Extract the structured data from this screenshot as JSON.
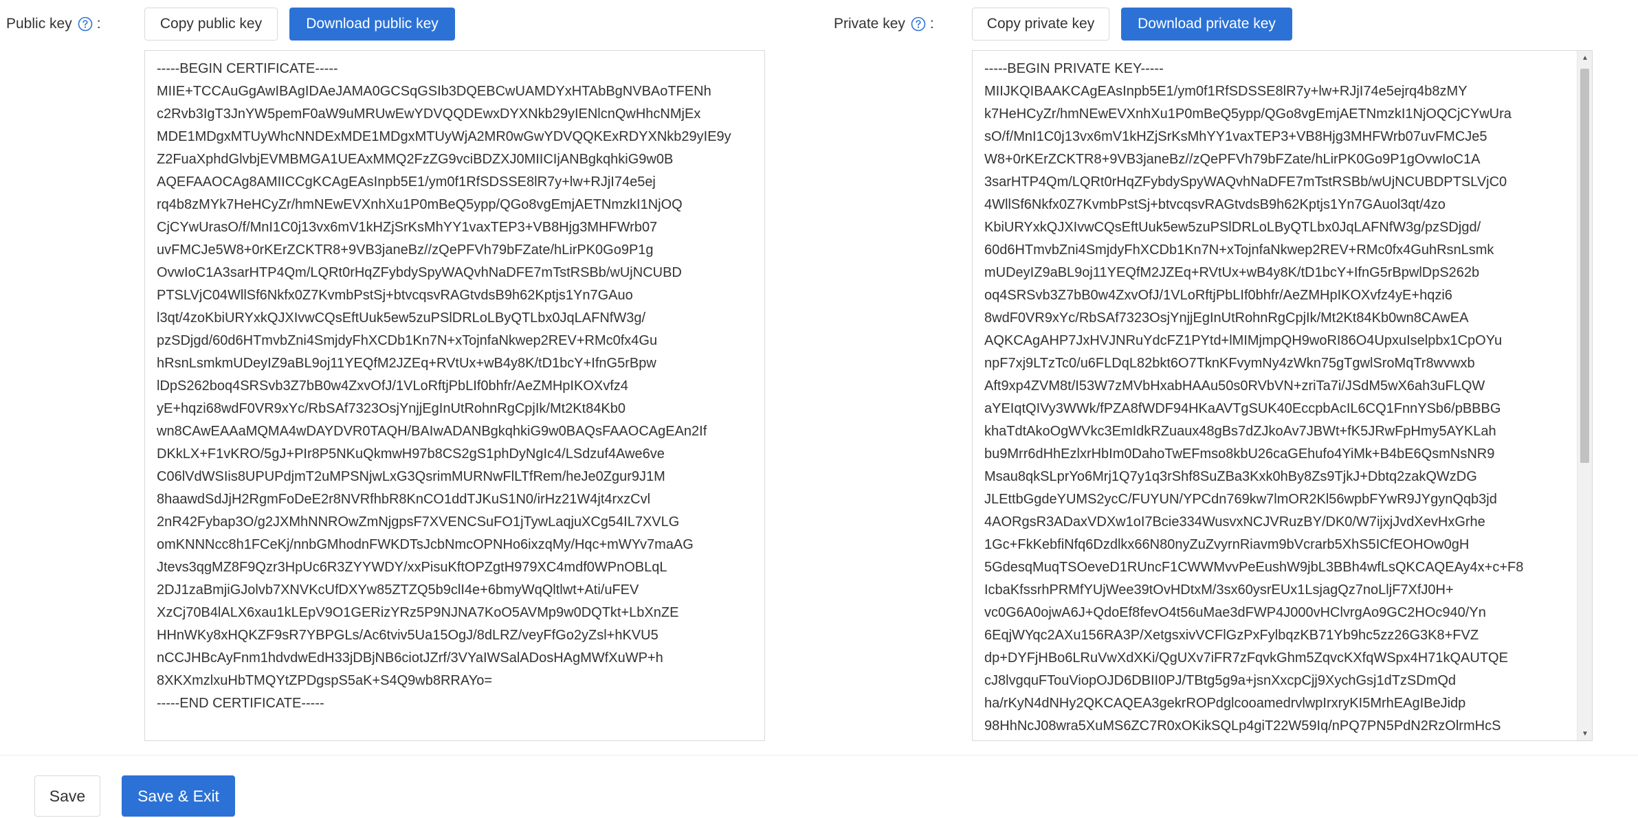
{
  "public_key": {
    "label": "Public key",
    "colon": ":",
    "copy_label": "Copy public key",
    "download_label": "Download public key",
    "content": "-----BEGIN CERTIFICATE-----\nMIIE+TCCAuGgAwIBAgIDAeJAMA0GCSqGSIb3DQEBCwUAMDYxHTAbBgNVBAoTFENh\nc2Rvb3IgT3JnYW5pemF0aW9uMRUwEwYDVQQDEwxDYXNkb29yIENlcnQwHhcNMjEx\nMDE1MDgxMTUyWhcNNDExMDE1MDgxMTUyWjA2MR0wGwYDVQQKExRDYXNkb29yIE9y\nZ2FuaXphdGlvbjEVMBMGA1UEAxMMQ2FzZG9vciBDZXJ0MIICIjANBgkqhkiG9w0B\nAQEFAAOCAg8AMIICCgKCAgEAsInpb5E1/ym0f1RfSDSSE8lR7y+lw+RJjI74e5ej\nrq4b8zMYk7HeHCyZr/hmNEwEVXnhXu1P0mBeQ5ypp/QGo8vgEmjAETNmzkI1NjOQ\nCjCYwUrasO/f/MnI1C0j13vx6mV1kHZjSrKsMhYY1vaxTEP3+VB8Hjg3MHFWrb07\nuvFMCJe5W8+0rKErZCKTR8+9VB3janeBz//zQePFVh79bFZate/hLirPK0Go9P1g\nOvwIoC1A3sarHTP4Qm/LQRt0rHqZFybdySpyWAQvhNaDFE7mTstRSBb/wUjNCUBD\nPTSLVjC04WllSf6Nkfx0Z7KvmbPstSj+btvcqsvRAGtvdsB9h62Kptjs1Yn7GAuo\nl3qt/4zoKbiURYxkQJXIvwCQsEftUuk5ew5zuPSlDRLoLByQTLbx0JqLAFNfW3g/\npzSDjgd/60d6HTmvbZni4SmjdyFhXCDb1Kn7N+xTojnfaNkwep2REV+RMc0fx4Gu\nhRsnLsmkmUDeyIZ9aBL9oj11YEQfM2JZEq+RVtUx+wB4y8K/tD1bcY+IfnG5rBpw\nlDpS262boq4SRSvb3Z7bB0w4ZxvOfJ/1VLoRftjPbLIf0bhfr/AeZMHpIKOXvfz4\nyE+hqzi68wdF0VR9xYc/RbSAf7323OsjYnjjEgInUtRohnRgCpjIk/Mt2Kt84Kb0\nwn8CAwEAAaMQMA4wDAYDVR0TAQH/BAIwADANBgkqhkiG9w0BAQsFAAOCAgEAn2If\nDKkLX+F1vKRO/5gJ+PIr8P5NKuQkmwH97b8CS2gS1phDyNgIc4/LSdzuf4Awe6ve\nC06lVdWSIis8UPUPdjmT2uMPSNjwLxG3QsrimMURNwFlLTfRem/heJe0Zgur9J1M\n8haawdSdJjH2RgmFoDeE2r8NVRfhbR8KnCO1ddTJKuS1N0/irHz21W4jt4rxzCvl\n2nR42Fybap3O/g2JXMhNNROwZmNjgpsF7XVENCSuFO1jTywLaqjuXCg54IL7XVLG\nomKNNNcc8h1FCeKj/nnbGMhodnFWKDTsJcbNmcOPNHo6ixzqMy/Hqc+mWYv7maAG\nJtevs3qgMZ8F9Qzr3HpUc6R3ZYYWDY/xxPisuKftOPZgtH979XC4mdf0WPnOBLqL\n2DJ1zaBmjiGJolvb7XNVKcUfDXYw85ZTZQ5b9clI4e+6bmyWqQltlwt+Ati/uFEV\nXzCj70B4lALX6xau1kLEpV9O1GERizYRz5P9NJNA7KoO5AVMp9w0DQTkt+LbXnZE\nHHnWKy8xHQKZF9sR7YBPGLs/Ac6tviv5Ua15OgJ/8dLRZ/veyFfGo2yZsl+hKVU5\nnCCJHBcAyFnm1hdvdwEdH33jDBjNB6ciotJZrf/3VYaIWSalADosHAgMWfXuWP+h\n8XKXmzlxuHbTMQYtZPDgspS5aK+S4Q9wb8RRAYo=\n-----END CERTIFICATE-----"
  },
  "private_key": {
    "label": "Private key",
    "colon": ":",
    "copy_label": "Copy private key",
    "download_label": "Download private key",
    "content": "-----BEGIN PRIVATE KEY-----\nMIIJKQIBAAKCAgEAsInpb5E1/ym0f1RfSDSSE8lR7y+lw+RJjI74e5ejrq4b8zMY\nk7HeHCyZr/hmNEwEVXnhXu1P0mBeQ5ypp/QGo8vgEmjAETNmzkI1NjOQCjCYwUra\nsO/f/MnI1C0j13vx6mV1kHZjSrKsMhYY1vaxTEP3+VB8Hjg3MHFWrb07uvFMCJe5\nW8+0rKErZCKTR8+9VB3janeBz//zQePFVh79bFZate/hLirPK0Go9P1gOvwIoC1A\n3sarHTP4Qm/LQRt0rHqZFybdySpyWAQvhNaDFE7mTstRSBb/wUjNCUBDPTSLVjC0\n4WllSf6Nkfx0Z7KvmbPstSj+btvcqsvRAGtvdsB9h62Kptjs1Yn7GAuol3qt/4zo\nKbiURYxkQJXIvwCQsEftUuk5ew5zuPSlDRLoLByQTLbx0JqLAFNfW3g/pzSDjgd/\n60d6HTmvbZni4SmjdyFhXCDb1Kn7N+xTojnfaNkwep2REV+RMc0fx4GuhRsnLsmk\nmUDeyIZ9aBL9oj11YEQfM2JZEq+RVtUx+wB4y8K/tD1bcY+IfnG5rBpwlDpS262b\noq4SRSvb3Z7bB0w4ZxvOfJ/1VLoRftjPbLIf0bhfr/AeZMHpIKOXvfz4yE+hqzi6\n8wdF0VR9xYc/RbSAf7323OsjYnjjEgInUtRohnRgCpjIk/Mt2Kt84Kb0wn8CAwEA\nAQKCAgAHP7JxHVJNRuYdcFZ1PYtd+lMIMjmpQH9woRI86O4UpxuIselpbx1CpOYu\nnpF7xj9LTzTc0/u6FLDqL82bkt6O7TknKFvymNy4zWkn75gTgwlSroMqTr8wvwxb\nAft9xp4ZVM8t/I53W7zMVbHxabHAAu50s0RVbVN+zriTa7i/JSdM5wX6ah3uFLQW\naYEIqtQIVy3WWk/fPZA8fWDF94HKaAVTgSUK40EccpbAcIL6CQ1FnnYSb6/pBBBG\nkhaTdtAkoOgWVkc3EmIdkRZuaux48gBs7dZJkoAv7JBWt+fK5JRwFpHmy5AYKLah\nbu9Mrr6dHhEzlxrHbIm0DahoTwEFmso8kbU26caGEhufo4YiMk+B4bE6QsmNsNR9\nMsau8qkSLprYo6Mrj1Q7y1q3rShf8SuZBa3Kxk0hBy8Zs9TjkJ+Dbtq2zakQWzDG\nJLEttbGgdeYUMS2ycC/FUYUN/YPCdn769kw7lmOR2Kl56wpbFYwR9JYgynQqb3jd\n4AORgsR3ADaxVDXw1oI7Bcie334WusvxNCJVRuzBY/DK0/W7ijxjJvdXevHxGrhe\n1Gc+FkKebfiNfq6Dzdlkx66N80nyZuZvyrnRiavm9bVcrarb5XhS5ICfEOHOw0gH\n5GdesqMuqTSOeveD1RUncF1CWWMvvPeEushW9jbL3BBh4wfLsQKCAQEAy4x+c+F8\nIcbaKfssrhPRMfYUjWee39tOvHDtxM/3sx60ysrEUx1LsjagQz7noLljF7XfJ0H+\nvc0G6A0ojwA6J+QdoEf8fevO4t56uMae3dFWP4J000vHClvrgAo9GC2HOc940/Yn\n6EqjWYqc2AXu156RA3P/XetgsxivVCFlGzPxFylbqzKB71Yb9hc5zz26G3K8+FVZ\ndp+DYFjHBo6LRuVwXdXKi/QgUXv7iFR7zFqvkGhm5ZqvcKXfqWSpx4H71kQAUTQE\ncJ8lvgquFTouViopOJD6DBII0PJ/TBtg5g9a+jsnXxcpCjj9XychGsj1dTzSDmQd\nha/rKyN4dNHy2QKCAQEA3gekrROPdglcooamedrvlwpIrxryKI5MrhEAgIBeJidp\n98HhNcJ08wra5XuMS6ZC7R0xOKikSQLp4giT22W59Iq/nPQ7PN5PdN2RzOlrmHcS"
  },
  "footer": {
    "save_label": "Save",
    "save_exit_label": "Save & Exit"
  },
  "colors": {
    "primary": "#2c72d6",
    "help_icon": "#2c72d6",
    "border": "#d9d9d9"
  },
  "icons": {
    "help": "question-circle-icon",
    "scroll_up": "triangle-up",
    "scroll_down": "triangle-down"
  }
}
